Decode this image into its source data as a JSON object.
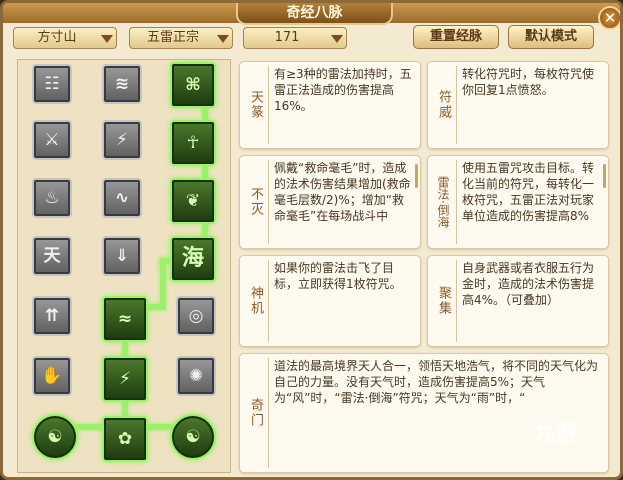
{
  "window": {
    "title": "奇经八脉",
    "close_label": "✕"
  },
  "filters": {
    "school": "方寸山",
    "scheme": "五雷正宗",
    "level": "171"
  },
  "buttons": {
    "reset": "重置经脉",
    "default_mode": "默认模式"
  },
  "grid": {
    "col1": [
      {
        "icon": "☷",
        "name": "gear-rune-icon"
      },
      {
        "icon": "⚔",
        "name": "blade-icon"
      },
      {
        "icon": "♨",
        "name": "flame-icon"
      },
      {
        "icon": "天",
        "name": "heaven-glyph-icon"
      },
      {
        "icon": "⇈",
        "name": "up-arrows-icon"
      },
      {
        "icon": "✋",
        "name": "hand-icon"
      },
      {
        "icon": "☯",
        "name": "swirl-icon"
      }
    ],
    "col2": [
      {
        "icon": "≋",
        "name": "wave-icon"
      },
      {
        "icon": "⚡",
        "name": "lightning-icon"
      },
      {
        "icon": "∿",
        "name": "serpent-icon"
      },
      {
        "icon": "⇓",
        "name": "down-arrow-icon"
      },
      {
        "icon": "≈",
        "name": "water-icon"
      },
      {
        "icon": "⚡",
        "name": "thunder-cards-icon"
      },
      {
        "icon": "✿",
        "name": "spirit-icon"
      }
    ],
    "col3": [
      {
        "icon": "⌘",
        "name": "talisman-book-icon"
      },
      {
        "icon": "☥",
        "name": "figure-icon"
      },
      {
        "icon": "❦",
        "name": "feather-icon"
      },
      {
        "icon": "海",
        "name": "sea-glyph-icon"
      },
      {
        "icon": "◎",
        "name": "ring-icon"
      },
      {
        "icon": "✺",
        "name": "burst-icon"
      },
      {
        "icon": "☯",
        "name": "swirl-icon"
      }
    ]
  },
  "cards": [
    {
      "name": "天篆",
      "desc": "有≥3种的雷法加持时，五雷正法造成的伤害提高16%。"
    },
    {
      "name": "符威",
      "desc": "转化符咒时，每枚符咒使你回复1点愤怒。"
    },
    {
      "name": "不灭",
      "desc": "佩戴“救命毫毛”时，造成的法术伤害结果增加(救命毫毛层数/2)%；增加“救命毫毛”在每场战斗中"
    },
    {
      "name": "雷法·倒海",
      "desc": "使用五雷咒攻击目标。转化当前的符咒，每转化一枚符咒，五雷正法对玩家单位造成的伤害提高8%"
    },
    {
      "name": "神机",
      "desc": "如果你的雷法击飞了目标，立即获得1枚符咒。"
    },
    {
      "name": "聚集",
      "desc": "自身武器或者衣服五行为金时，造成的法术伤害提高4%。（可叠加）"
    },
    {
      "name": "奇门",
      "desc": "道法的最高境界天人合一，领悟天地浩气，将不同的天气化为自己的力量。没有天气时，造成伤害提高5%；天气为“风”时，“雷法·倒海”符咒；天气为“雨”时，“"
    }
  ],
  "watermark": "九游"
}
